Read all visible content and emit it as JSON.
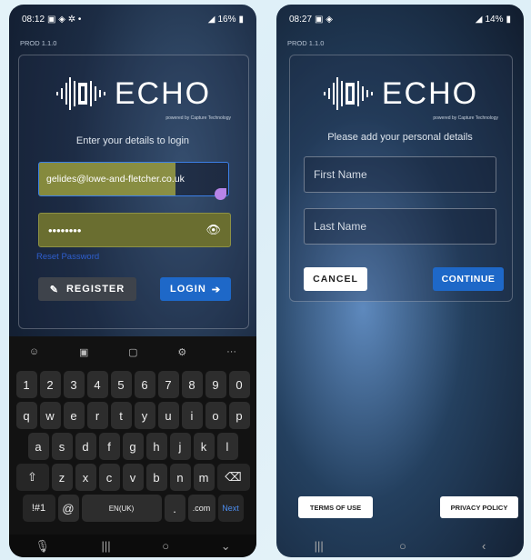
{
  "left_phone": {
    "status": {
      "time": "08:12",
      "battery": "16%"
    },
    "version": "PROD 1.1.0",
    "logo": {
      "brand": "ECHO",
      "powered_by": "powered by Capture Technology"
    },
    "subtitle": "Enter your details to login",
    "email_value": "gelides@lowe-and-fletcher.co.uk",
    "password_value": "••••••••",
    "reset_link": "Reset Password",
    "register_label": "REGISTER",
    "login_label": "LOGIN",
    "keyboard": {
      "numbers": [
        "1",
        "2",
        "3",
        "4",
        "5",
        "6",
        "7",
        "8",
        "9",
        "0"
      ],
      "row1": [
        "q",
        "w",
        "e",
        "r",
        "t",
        "y",
        "u",
        "i",
        "o",
        "p"
      ],
      "row2": [
        "a",
        "s",
        "d",
        "f",
        "g",
        "h",
        "j",
        "k",
        "l"
      ],
      "row3": [
        "z",
        "x",
        "c",
        "v",
        "b",
        "n",
        "m"
      ],
      "bottom": {
        "symbols": "!#1",
        "at": "@",
        "space": "EN(UK)",
        "dot": ".",
        "com": ".com",
        "next": "Next"
      }
    }
  },
  "right_phone": {
    "status": {
      "time": "08:27",
      "battery": "14%"
    },
    "version": "PROD 1.1.0",
    "logo": {
      "brand": "ECHO",
      "powered_by": "powered by Capture Technology"
    },
    "subtitle": "Please add your personal details",
    "first_name_placeholder": "First Name",
    "last_name_placeholder": "Last Name",
    "cancel_label": "CANCEL",
    "continue_label": "CONTINUE",
    "terms_label": "TERMS OF USE",
    "privacy_label": "PRIVACY POLICY"
  },
  "colors": {
    "primary": "#1e68c8",
    "autofill": "#8a8f44",
    "accent_link": "#2f5fcf"
  }
}
